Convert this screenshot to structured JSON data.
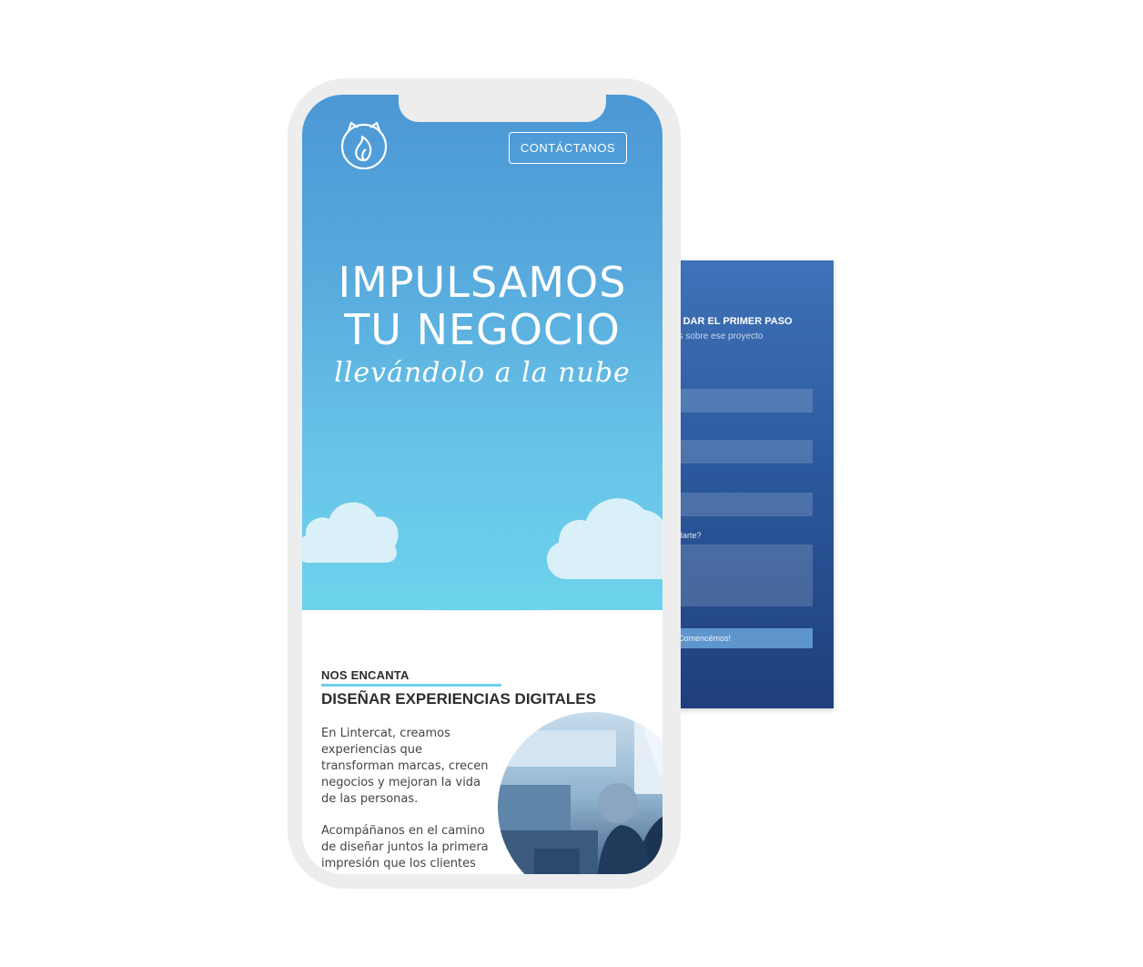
{
  "header": {
    "contact_label": "CONTÁCTANOS"
  },
  "hero": {
    "headline_line1": "IMPULSAMOS",
    "headline_line2": "TU NEGOCIO",
    "tagline": "llevándolo a la nube"
  },
  "about": {
    "eyebrow": "NOS ENCANTA",
    "title": "DISEÑAR EXPERIENCIAS DIGITALES",
    "paragraph1": "En Lintercat, creamos experiencias que transforman marcas, crecen negocios y mejoran la vida de las personas.",
    "paragraph2": "Acompáñanos en el camino de diseñar juntos la primera impresión que los clientes"
  },
  "form": {
    "title": "A DAR EL PRIMER PASO",
    "subtitle": "os sobre ese proyecto",
    "message_label": "adarte?",
    "submit_label": "Comencémos!"
  },
  "colors": {
    "hero_top": "#4b97d5",
    "hero_bottom": "#6dd2ec",
    "accent_rule": "#6fd0ec",
    "form_top": "#3f72b9",
    "form_bottom": "#1f3f7c",
    "phone_frame": "#ededed"
  },
  "icons": {
    "logo": "cat-flame-logo-icon",
    "clouds": "cloud-icon"
  }
}
